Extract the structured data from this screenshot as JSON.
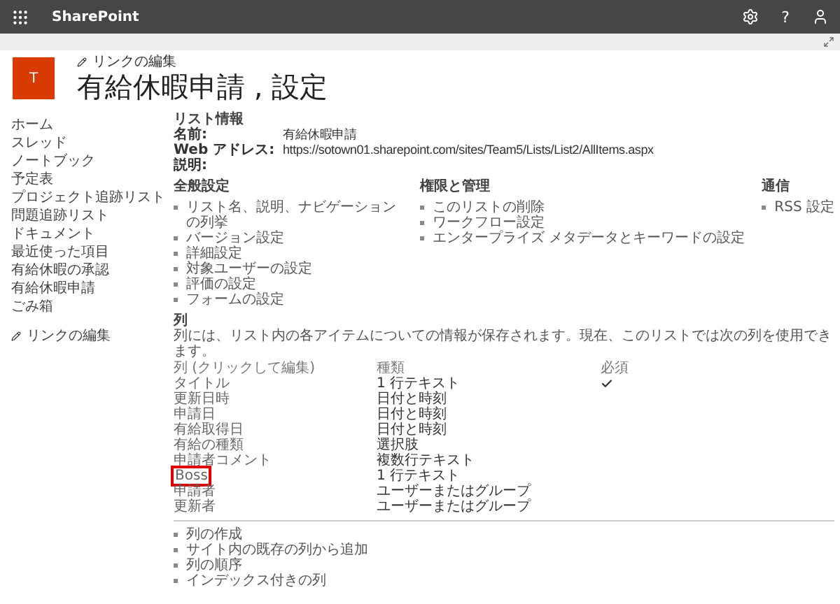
{
  "top_bar": {
    "app_name": "SharePoint",
    "help_glyph": "?"
  },
  "site": {
    "logo_letter": "T",
    "edit_links": "リンクの編集",
    "title": "有給休暇申請 , 設定"
  },
  "nav": {
    "items": [
      {
        "label": "ホーム"
      },
      {
        "label": "スレッド"
      },
      {
        "label": "ノートブック"
      },
      {
        "label": "予定表"
      },
      {
        "label": "プロジェクト追跡リスト"
      },
      {
        "label": "問題追跡リスト"
      },
      {
        "label": "ドキュメント"
      },
      {
        "label": "最近使った項目"
      },
      {
        "label": "有給休暇の承認"
      },
      {
        "label": "有給休暇申請"
      },
      {
        "label": "ごみ箱"
      }
    ],
    "edit_links": "リンクの編集"
  },
  "list_info": {
    "heading": "リスト情報",
    "fields": [
      {
        "label": "名前:",
        "value": "有給休暇申請"
      },
      {
        "label": "Web アドレス:",
        "value": "https://sotown01.sharepoint.com/sites/Team5/Lists/List2/AllItems.aspx"
      },
      {
        "label": "説明:"
      }
    ]
  },
  "settings_groups": [
    {
      "heading": "全般設定",
      "links": [
        "リスト名、説明、ナビゲーションの列挙",
        "バージョン設定",
        "詳細設定",
        "対象ユーザーの設定",
        "評価の設定",
        "フォームの設定"
      ]
    },
    {
      "heading": "権限と管理",
      "links": [
        "このリストの削除",
        "ワークフロー設定",
        "エンタープライズ メタデータとキーワードの設定"
      ]
    },
    {
      "heading": "通信",
      "links": [
        "RSS 設定"
      ]
    }
  ],
  "columns": {
    "heading": "列",
    "description": "列には、リスト内の各アイテムについての情報が保存されます。現在、このリストでは次の列を使用できます。",
    "table_headers": [
      "列 (クリックして編集)",
      "種類",
      "必須"
    ],
    "rows": [
      {
        "name": "タイトル",
        "type": "1 行テキスト",
        "required": true,
        "highlighted": false
      },
      {
        "name": "更新日時",
        "type": "日付と時刻",
        "required": false,
        "highlighted": false
      },
      {
        "name": "申請日",
        "type": "日付と時刻",
        "required": false,
        "highlighted": false
      },
      {
        "name": "有給取得日",
        "type": "日付と時刻",
        "required": false,
        "highlighted": false
      },
      {
        "name": "有給の種類",
        "type": "選択肢",
        "required": false,
        "highlighted": false
      },
      {
        "name": "申請者コメント",
        "type": "複数行テキスト",
        "required": false,
        "highlighted": false
      },
      {
        "name": "Boss",
        "type": "1 行テキスト",
        "required": false,
        "highlighted": true
      },
      {
        "name": "申請者",
        "type": "ユーザーまたはグループ",
        "required": false,
        "highlighted": false
      },
      {
        "name": "更新者",
        "type": "ユーザーまたはグループ",
        "required": false,
        "highlighted": false
      }
    ],
    "links": [
      "列の作成",
      "サイト内の既存の列から追加",
      "列の順序",
      "インデックス付きの列"
    ]
  }
}
